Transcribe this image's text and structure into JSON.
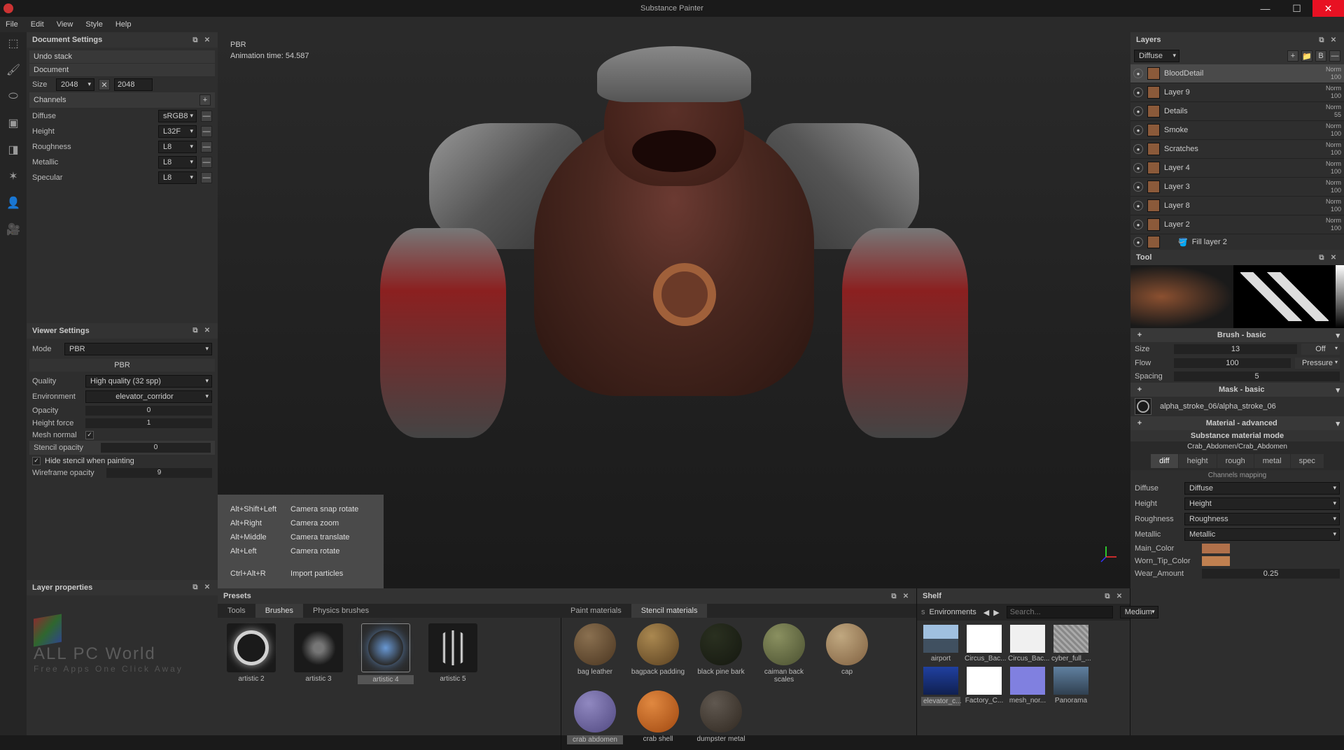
{
  "app": {
    "title": "Substance Painter"
  },
  "menu": {
    "file": "File",
    "edit": "Edit",
    "view": "View",
    "style": "Style",
    "help": "Help"
  },
  "doc_settings": {
    "title": "Document Settings",
    "undo_stack": "Undo stack",
    "document": "Document",
    "size_label": "Size",
    "size_value": "2048",
    "size_value2": "2048",
    "channels": "Channels",
    "ch": [
      {
        "name": "Diffuse",
        "fmt": "sRGB8"
      },
      {
        "name": "Height",
        "fmt": "L32F"
      },
      {
        "name": "Roughness",
        "fmt": "L8"
      },
      {
        "name": "Metallic",
        "fmt": "L8"
      },
      {
        "name": "Specular",
        "fmt": "L8"
      }
    ]
  },
  "viewer": {
    "title": "Viewer Settings",
    "mode_label": "Mode",
    "mode_value": "PBR",
    "group": "PBR",
    "quality_label": "Quality",
    "quality_value": "High quality (32 spp)",
    "env_label": "Environment",
    "env_value": "elevator_corridor",
    "opacity_label": "Opacity",
    "opacity_value": "0",
    "heightforce_label": "Height force",
    "heightforce_value": "1",
    "meshnormal_label": "Mesh normal",
    "stencil_opacity_label": "Stencil opacity",
    "stencil_opacity_value": "0",
    "hide_stencil": "Hide stencil when painting",
    "wireframe_label": "Wireframe opacity",
    "wireframe_value": "9"
  },
  "viewport": {
    "shader": "PBR",
    "anim_time": "Animation time: 54.587"
  },
  "shortcuts": {
    "r1k": "Alt+Shift+Left",
    "r1v": "Camera snap rotate",
    "r2k": "Alt+Right",
    "r2v": "Camera zoom",
    "r3k": "Alt+Middle",
    "r3v": "Camera translate",
    "r4k": "Alt+Left",
    "r4v": "Camera rotate",
    "r5k": "Ctrl+Alt+R",
    "r5v": "Import particles"
  },
  "layers": {
    "title": "Layers",
    "set": "Diffuse",
    "items": [
      {
        "name": "BloodDetail",
        "mode": "Norm",
        "op": "100"
      },
      {
        "name": "Layer 9",
        "mode": "Norm",
        "op": "100"
      },
      {
        "name": "Details",
        "mode": "Norm",
        "op": "55"
      },
      {
        "name": "Smoke",
        "mode": "Norm",
        "op": "100"
      },
      {
        "name": "Scratches",
        "mode": "Norm",
        "op": "100"
      },
      {
        "name": "Layer 4",
        "mode": "Norm",
        "op": "100"
      },
      {
        "name": "Layer 3",
        "mode": "Norm",
        "op": "100"
      },
      {
        "name": "Layer 8",
        "mode": "Norm",
        "op": "100"
      },
      {
        "name": "Layer 2",
        "mode": "Norm",
        "op": "100"
      },
      {
        "name": "Fill layer 2",
        "mode": "",
        "op": ""
      }
    ]
  },
  "tool": {
    "title": "Tool",
    "brush_header": "Brush - basic",
    "size_label": "Size",
    "size_value": "13",
    "size_btn": "Off",
    "flow_label": "Flow",
    "flow_value": "100",
    "flow_btn": "Pressure",
    "spacing_label": "Spacing",
    "spacing_value": "5",
    "mask_header": "Mask - basic",
    "mask_path": "alpha_stroke_06/alpha_stroke_06",
    "material_header": "Material - advanced",
    "material_mode": "Substance material mode",
    "material_name": "Crab_Abdomen/Crab_Abdomen",
    "tabs": {
      "diff": "diff",
      "height": "height",
      "rough": "rough",
      "metal": "metal",
      "spec": "spec"
    },
    "channels_mapping": "Channels mapping",
    "map": [
      {
        "l": "Diffuse",
        "v": "Diffuse"
      },
      {
        "l": "Height",
        "v": "Height"
      },
      {
        "l": "Roughness",
        "v": "Roughness"
      },
      {
        "l": "Metallic",
        "v": "Metallic"
      }
    ],
    "main_color": "Main_Color",
    "worn_tip": "Worn_Tip_Color",
    "wear_amount_label": "Wear_Amount",
    "wear_amount_value": "0.25"
  },
  "presets": {
    "title": "Presets",
    "tabs": {
      "tools": "Tools",
      "brushes": "Brushes",
      "physics": "Physics brushes"
    },
    "mat_tabs": {
      "paint": "Paint materials",
      "stencil": "Stencil materials"
    },
    "brushes": [
      "artistic 2",
      "artistic 3",
      "artistic 4",
      "artistic 5"
    ],
    "materials_top": [
      "bag leather",
      "bagpack padding",
      "black pine bark",
      "caiman back scales"
    ],
    "materials_bot": [
      "cap",
      "crab abdomen",
      "crab shell",
      "dumpster metal"
    ]
  },
  "shelf": {
    "title": "Shelf",
    "tab": "Environments",
    "search_placeholder": "Search...",
    "size": "Medium",
    "row1": [
      "airport",
      "Circus_Bac...",
      "Circus_Bac...",
      "cyber_full_..."
    ],
    "row2": [
      "elevator_c...",
      "Factory_C...",
      "mesh_nor...",
      "Panorama"
    ]
  },
  "layer_props": {
    "title": "Layer properties"
  }
}
